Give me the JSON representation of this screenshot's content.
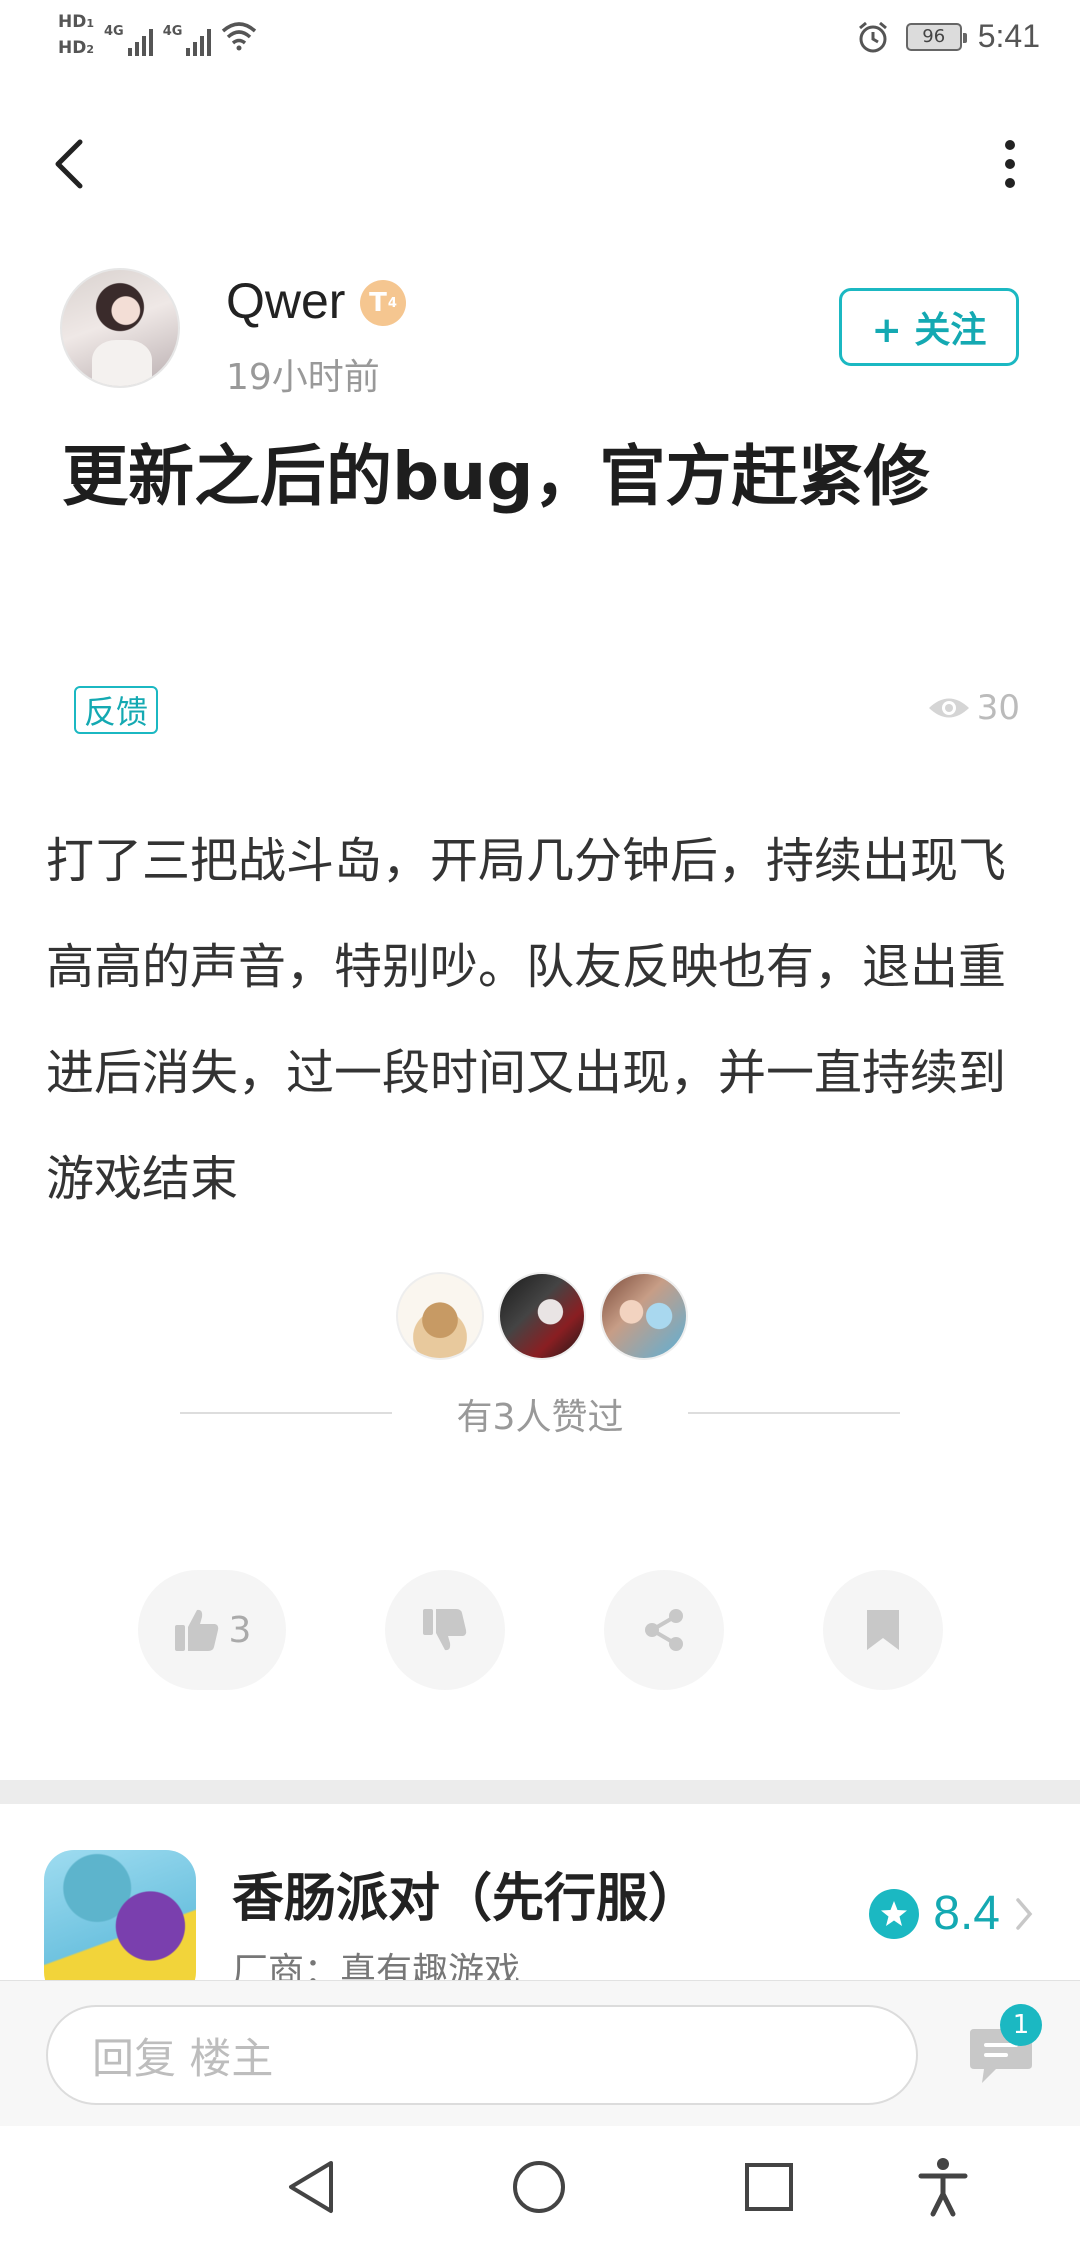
{
  "status_bar": {
    "hd1": "HD",
    "hd1_sub": "1",
    "hd2": "HD",
    "hd2_sub": "2",
    "network1": "4G",
    "network2": "4G",
    "battery": "96",
    "time": "5:41"
  },
  "author": {
    "name": "Qwer",
    "level_badge": "T",
    "level_sub": "4",
    "time_ago": "19小时前",
    "follow_label": "+ 关注"
  },
  "post": {
    "title": "更新之后的bug，官方赶紧修",
    "tag": "反馈",
    "views": "30",
    "body": "打了三把战斗岛，开局几分钟后，持续出现飞高高的声音，特别吵。队友反映也有，退出重进后消失，过一段时间又出现，并一直持续到游戏结束"
  },
  "likers": {
    "summary": "有3人赞过"
  },
  "actions": {
    "like_count": "3"
  },
  "game": {
    "name": "香肠派对（先行服）",
    "vendor": "厂商：真有趣游戏",
    "rating": "8.4"
  },
  "reply": {
    "placeholder": "回复  楼主",
    "comment_badge": "1"
  },
  "colors": {
    "accent": "#1bb8c2",
    "text_primary": "#222222",
    "text_secondary": "#999999"
  }
}
